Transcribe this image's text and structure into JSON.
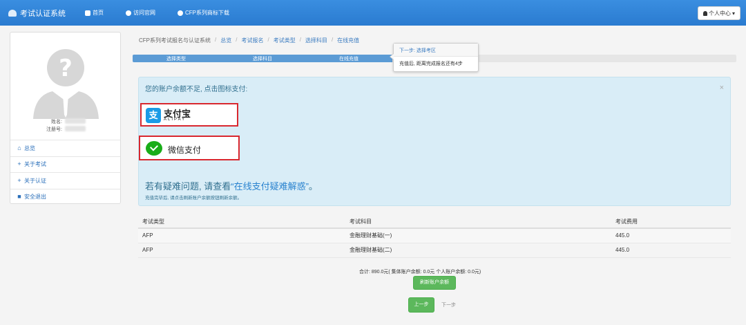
{
  "navbar": {
    "brand": "考试认证系统",
    "items": [
      "首页",
      "访问官网",
      "CFP系列商标下载"
    ],
    "user_menu": "个人中心"
  },
  "profile": {
    "name_label": "姓名:",
    "reg_label": "注册号:"
  },
  "sidebar": {
    "items": [
      {
        "icon": "home-icon",
        "label": "总览"
      },
      {
        "icon": "plus-icon",
        "label": "关于考试"
      },
      {
        "icon": "plus-icon",
        "label": "关于认证"
      },
      {
        "icon": "lock-icon",
        "label": "安全退出"
      }
    ]
  },
  "breadcrumb": [
    "CFP系列考试报名与认证系统",
    "总览",
    "考试报名",
    "考试类型",
    "选择科目",
    "在线充值"
  ],
  "progress": {
    "steps": [
      "选择类型",
      "选择科目",
      "在线充值"
    ],
    "fraction": 0.43
  },
  "tooltip": {
    "title": "下一步: 选择考区",
    "body": "充值后, 距离完成报名还有4步"
  },
  "alert": {
    "message": "您的账户余额不足, 点击图标支付:",
    "close": "×",
    "alipay": {
      "name": "支付宝",
      "sub": "ALIPAY"
    },
    "wechat": {
      "name": "微信支付"
    },
    "help_prefix": "若有疑难问题, 请查看",
    "help_link": "“在线支付疑难解惑”",
    "help_suffix": "。",
    "note": "充值完毕后, 请点击刷新账户余额按钮刷新余额。"
  },
  "table": {
    "headers": [
      "考试类型",
      "考试科目",
      "考试费用"
    ],
    "rows": [
      [
        "AFP",
        "金融理财基础(一)",
        "445.0"
      ],
      [
        "AFP",
        "金融理财基础(二)",
        "445.0"
      ]
    ]
  },
  "summary": "合计: 890.0元( 集体账户余额: 0.0元    个人账户余额: 0.0元)",
  "buttons": {
    "refresh": "刷新账户余额",
    "prev": "上一步",
    "next": "下一步"
  }
}
